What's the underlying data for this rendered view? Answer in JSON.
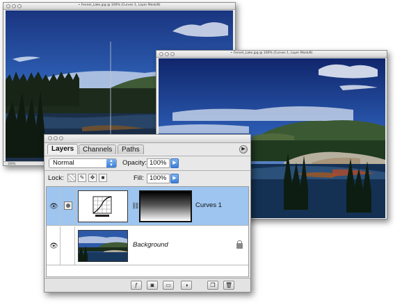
{
  "window_left": {
    "title": "• Fennel_Lake.jpg @ 100% (Curves 1, Layer Mask/8)",
    "status": "100%"
  },
  "window_right": {
    "title": "• Fennel_Lake.jpg @ 100% (Curves 1, Layer Mask/8)"
  },
  "palette": {
    "tabs": [
      {
        "label": "Layers",
        "active": true
      },
      {
        "label": "Channels",
        "active": false
      },
      {
        "label": "Paths",
        "active": false
      }
    ],
    "blend_mode": "Normal",
    "opacity_label": "Opacity:",
    "opacity_value": "100%",
    "lock_label": "Lock:",
    "fill_label": "Fill:",
    "fill_value": "100%",
    "layers": [
      {
        "name": "Curves 1",
        "selected": true,
        "italic": false
      },
      {
        "name": "Background",
        "selected": false,
        "italic": true
      }
    ],
    "bottom_buttons": [
      "link-layers",
      "add-style",
      "add-mask",
      "new-group",
      "new-adjustment",
      "new-layer",
      "delete"
    ]
  },
  "colors": {
    "selection": "#9ec5f0",
    "blue_control": "#3a7fd9"
  }
}
